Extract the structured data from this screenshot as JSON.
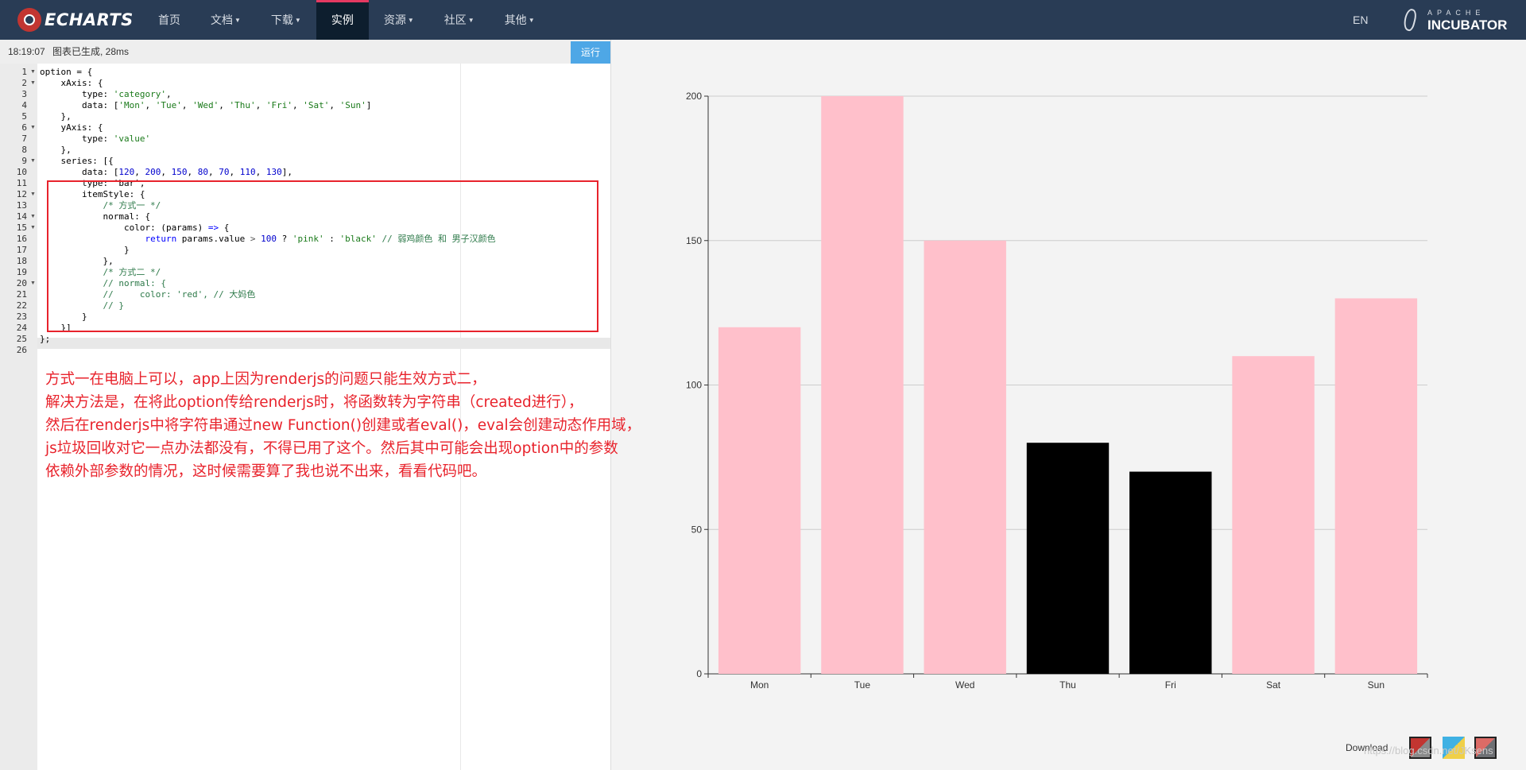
{
  "nav": {
    "logo": "ECHARTS",
    "items": [
      {
        "label": "首页",
        "caret": false
      },
      {
        "label": "文档",
        "caret": true
      },
      {
        "label": "下载",
        "caret": true
      },
      {
        "label": "实例",
        "caret": false
      },
      {
        "label": "资源",
        "caret": true
      },
      {
        "label": "社区",
        "caret": true
      },
      {
        "label": "其他",
        "caret": true
      }
    ],
    "active_index": 3,
    "lang": "EN",
    "incubator_small": "APACHE",
    "incubator_big": "INCUBATOR"
  },
  "editor": {
    "status_time": "18:19:07",
    "status_msg": "图表已生成, 28ms",
    "run_label": "运行",
    "lines": [
      [
        [
          "k",
          "option = {"
        ]
      ],
      [
        [
          "k",
          "    xAxis: {"
        ]
      ],
      [
        [
          "k",
          "        type: "
        ],
        [
          "s",
          "'category'"
        ],
        [
          "k",
          ","
        ]
      ],
      [
        [
          "k",
          "        data: ["
        ],
        [
          "s",
          "'Mon'"
        ],
        [
          "k",
          ", "
        ],
        [
          "s",
          "'Tue'"
        ],
        [
          "k",
          ", "
        ],
        [
          "s",
          "'Wed'"
        ],
        [
          "k",
          ", "
        ],
        [
          "s",
          "'Thu'"
        ],
        [
          "k",
          ", "
        ],
        [
          "s",
          "'Fri'"
        ],
        [
          "k",
          ", "
        ],
        [
          "s",
          "'Sat'"
        ],
        [
          "k",
          ", "
        ],
        [
          "s",
          "'Sun'"
        ],
        [
          "k",
          "]"
        ]
      ],
      [
        [
          "k",
          "    },"
        ]
      ],
      [
        [
          "k",
          "    yAxis: {"
        ]
      ],
      [
        [
          "k",
          "        type: "
        ],
        [
          "s",
          "'value'"
        ]
      ],
      [
        [
          "k",
          "    },"
        ]
      ],
      [
        [
          "k",
          "    series: [{"
        ]
      ],
      [
        [
          "k",
          "        data: ["
        ],
        [
          "n",
          "120"
        ],
        [
          "k",
          ", "
        ],
        [
          "n",
          "200"
        ],
        [
          "k",
          ", "
        ],
        [
          "n",
          "150"
        ],
        [
          "k",
          ", "
        ],
        [
          "n",
          "80"
        ],
        [
          "k",
          ", "
        ],
        [
          "n",
          "70"
        ],
        [
          "k",
          ", "
        ],
        [
          "n",
          "110"
        ],
        [
          "k",
          ", "
        ],
        [
          "n",
          "130"
        ],
        [
          "k",
          "],"
        ]
      ],
      [
        [
          "k",
          "        type: 'bar',"
        ]
      ],
      [
        [
          "k",
          "        itemStyle: {"
        ]
      ],
      [
        [
          "c",
          "            /* 方式一 */"
        ]
      ],
      [
        [
          "k",
          "            normal: {"
        ]
      ],
      [
        [
          "k",
          "                color: (params) "
        ],
        [
          "kw",
          "=>"
        ],
        [
          "k",
          " {"
        ]
      ],
      [
        [
          "kw",
          "                    return"
        ],
        [
          "k",
          " params.value "
        ],
        [
          "op",
          ">"
        ],
        [
          "k",
          " "
        ],
        [
          "n",
          "100"
        ],
        [
          "k",
          " ? "
        ],
        [
          "s",
          "'pink'"
        ],
        [
          "k",
          " : "
        ],
        [
          "s",
          "'black'"
        ],
        [
          "k",
          " "
        ],
        [
          "c",
          "// 弱鸡颜色 和 男子汉颜色"
        ]
      ],
      [
        [
          "k",
          "                }"
        ]
      ],
      [
        [
          "k",
          "            },"
        ]
      ],
      [
        [
          "c",
          "            /* 方式二 */"
        ]
      ],
      [
        [
          "c",
          "            // normal: {"
        ]
      ],
      [
        [
          "c",
          "            //     color: 'red', // 大妈色"
        ]
      ],
      [
        [
          "c",
          "            // }"
        ]
      ],
      [
        [
          "k",
          "        }"
        ]
      ],
      [
        [
          "k",
          "    }]"
        ]
      ],
      [
        [
          "k",
          "};"
        ]
      ],
      [
        [
          "k",
          ""
        ]
      ]
    ],
    "fold_lines": [
      1,
      2,
      6,
      9,
      12,
      14,
      15,
      20
    ]
  },
  "annotation": {
    "lines": [
      "方式一在电脑上可以，app上因为renderjs的问题只能生效方式二，",
      "解决方法是，在将此option传给renderjs时，将函数转为字符串（created进行），",
      "然后在renderjs中将字符串通过new Function()创建或者eval()，eval会创建动态作用域，",
      "js垃圾回收对它一点办法都没有，不得已用了这个。然后其中可能会出现option中的参数",
      "依赖外部参数的情况，这时候需要算了我也说不出来，看看代码吧。"
    ]
  },
  "chart_data": {
    "type": "bar",
    "categories": [
      "Mon",
      "Tue",
      "Wed",
      "Thu",
      "Fri",
      "Sat",
      "Sun"
    ],
    "values": [
      120,
      200,
      150,
      80,
      70,
      110,
      130
    ],
    "colors": [
      "#ffc0cb",
      "#ffc0cb",
      "#ffc0cb",
      "#000000",
      "#000000",
      "#ffc0cb",
      "#ffc0cb"
    ],
    "ylim": [
      0,
      200
    ],
    "yticks": [
      0,
      50,
      100,
      150,
      200
    ],
    "grid": true
  },
  "footer": {
    "download_label": "Download",
    "watermark": "https://blog.csdn.net/JKsens"
  }
}
